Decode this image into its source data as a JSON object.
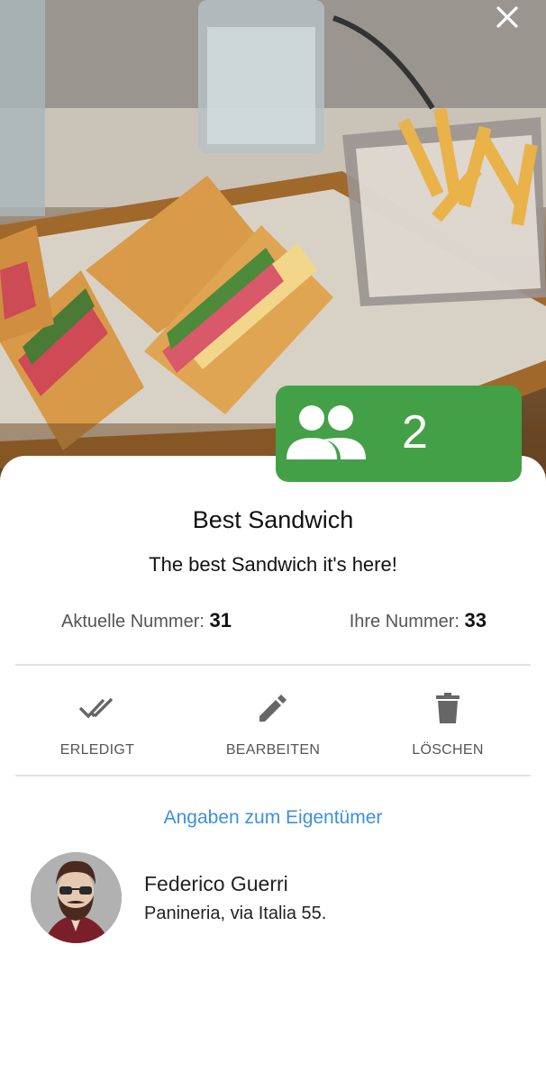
{
  "hero": {
    "image_alt": "Club sandwich with fries"
  },
  "close": {
    "icon": "close-icon"
  },
  "queue": {
    "count": "2",
    "icon": "people-icon",
    "color": "#43a047"
  },
  "item": {
    "title": "Best Sandwich",
    "description": "The best Sandwich it's here!"
  },
  "numbers": {
    "current_label": "Aktuelle Nummer:",
    "current_value": "31",
    "yours_label": "Ihre Nummer:",
    "yours_value": "33"
  },
  "actions": {
    "done_label": "ERLEDIGT",
    "edit_label": "BEARBEITEN",
    "delete_label": "LÖSCHEN"
  },
  "owner": {
    "section_link": "Angaben zum Eigentümer",
    "name": "Federico Guerri",
    "address": "Panineria, via Italia 55.",
    "link_color": "#3d8fe0"
  }
}
